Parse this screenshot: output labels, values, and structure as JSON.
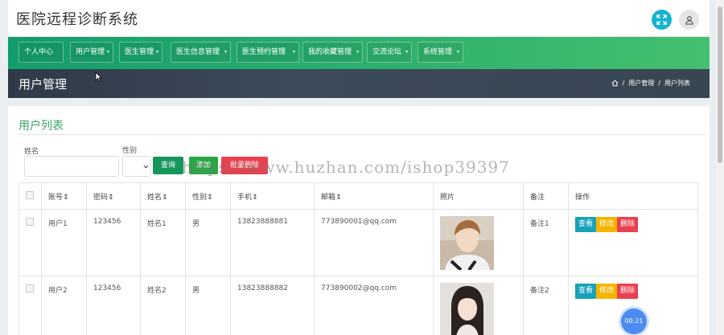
{
  "app": {
    "title": "医院远程诊断系统"
  },
  "nav": {
    "items": [
      {
        "label": "个人中心"
      },
      {
        "label": "用户管理"
      },
      {
        "label": "医生管理"
      },
      {
        "label": "医生信息管理"
      },
      {
        "label": "医生预约管理"
      },
      {
        "label": "我的收藏管理"
      },
      {
        "label": "交流论坛"
      },
      {
        "label": "系统管理"
      }
    ]
  },
  "header": {
    "title": "用户管理",
    "breadcrumb": [
      "用户管理",
      "用户列表"
    ],
    "separator": "/"
  },
  "main": {
    "section_title": "用户列表",
    "filters": {
      "name_label": "姓名",
      "name_value": "",
      "gender_label": "性别",
      "gender_value": ""
    },
    "buttons": {
      "query": "查询",
      "add": "添加",
      "batch_delete": "批量删除"
    },
    "table": {
      "columns": [
        "账号",
        "密码",
        "姓名",
        "性别",
        "手机",
        "邮箱",
        "照片",
        "备注",
        "操作"
      ],
      "sort_indicator": "⇕",
      "rows": [
        {
          "account": "用户1",
          "password": "123456",
          "name": "姓名1",
          "gender": "男",
          "phone": "13823888881",
          "email": "773890001@qq.com",
          "photo": "male-portrait",
          "remark": "备注1"
        },
        {
          "account": "用户2",
          "password": "123456",
          "name": "姓名2",
          "gender": "男",
          "phone": "13823888882",
          "email": "773890002@qq.com",
          "photo": "female-portrait",
          "remark": "备注2"
        }
      ],
      "actions": {
        "view": "查看",
        "edit": "修改",
        "delete": "删除"
      }
    }
  },
  "overlay": {
    "watermark": "https://www.huzhan.com/ishop39397",
    "timer": "00:21"
  },
  "colors": {
    "nav_start": "#139d6c",
    "nav_end": "#43c06e",
    "accent_green": "#3aa46a",
    "view": "#17a2b8",
    "edit": "#f5b400",
    "delete": "#e8414f",
    "fullscreen": "#15b3cf",
    "header_dark": "#2f3a48"
  },
  "icons": [
    "fullscreen-icon",
    "user-icon",
    "home-icon",
    "chevron-down-icon",
    "sort-icon",
    "cursor-icon"
  ]
}
